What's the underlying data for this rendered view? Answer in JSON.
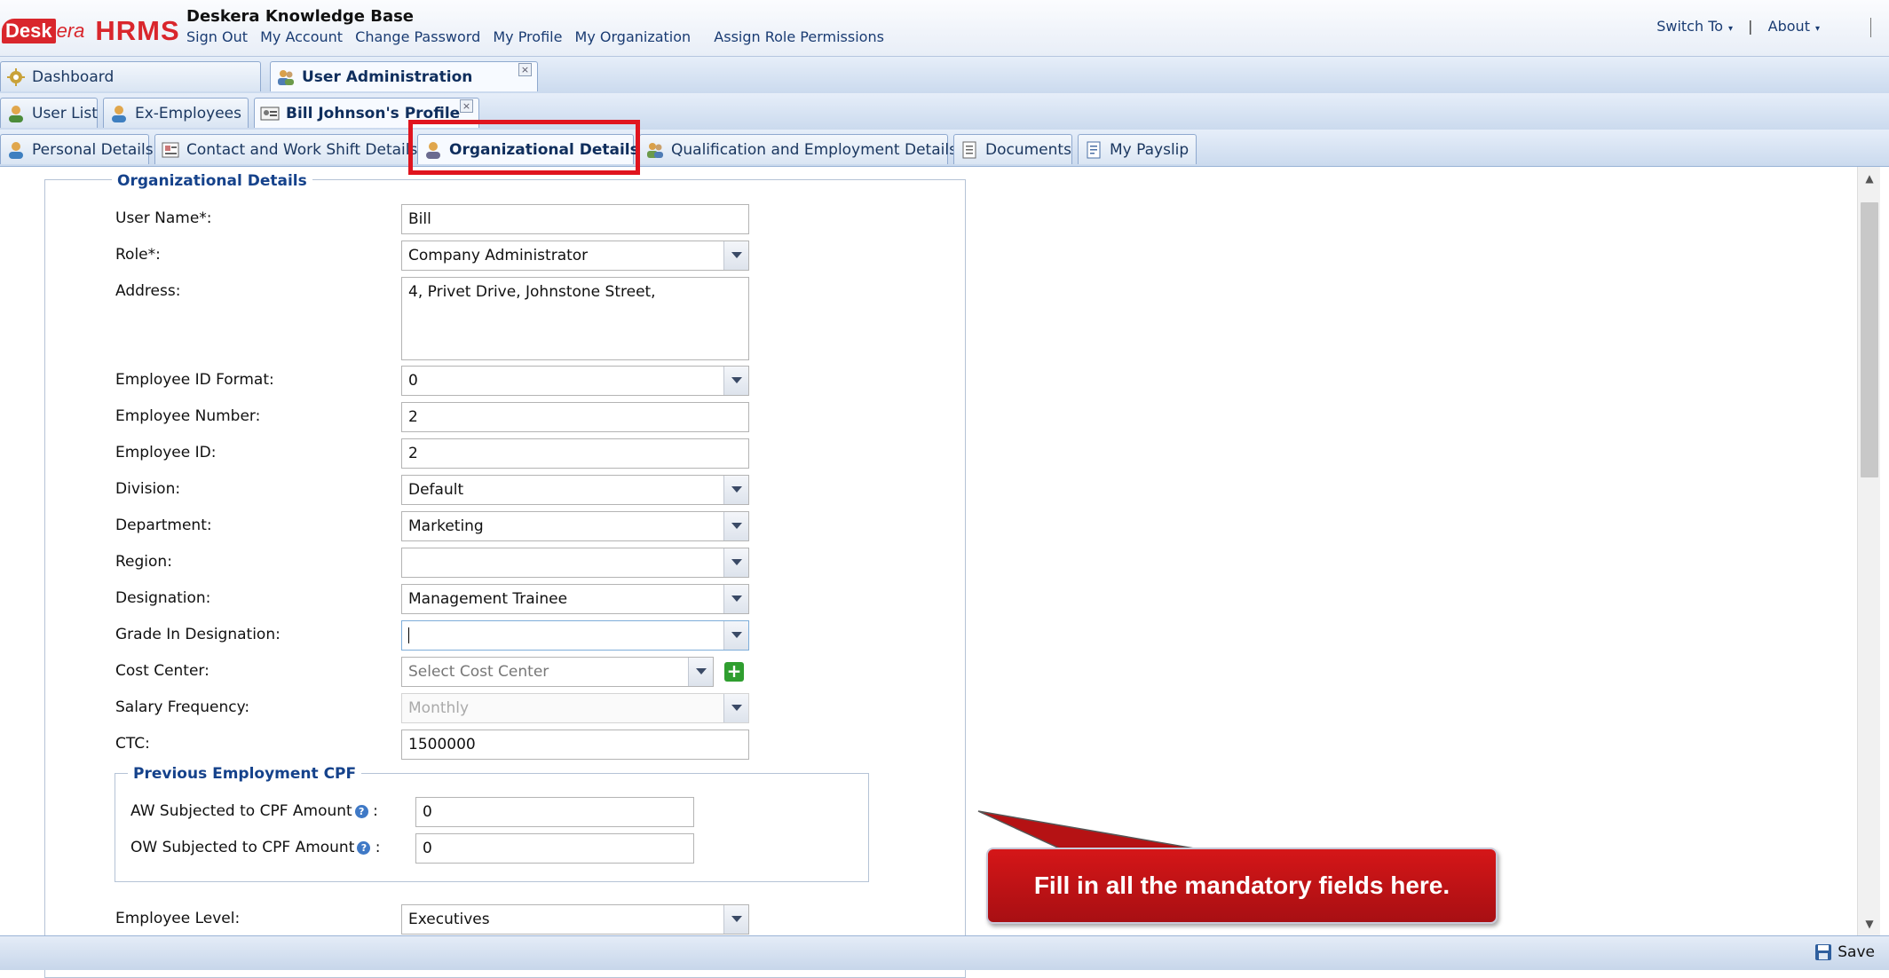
{
  "header": {
    "logo_desk": "Desk",
    "logo_era": "era",
    "logo_hrms": "HRMS",
    "title": "Deskera Knowledge Base",
    "links": [
      "Sign Out",
      "My Account",
      "Change Password",
      "My Profile",
      "My Organization",
      "Assign Role Permissions"
    ],
    "switch_to": "Switch To",
    "separator": "|",
    "about": "About"
  },
  "tabs_main": [
    {
      "label": "Dashboard"
    },
    {
      "label": "User Administration",
      "close": "×"
    }
  ],
  "tabs_users": [
    {
      "label": "User List"
    },
    {
      "label": "Ex-Employees"
    },
    {
      "label": "Bill Johnson's Profile",
      "close": "×"
    }
  ],
  "tabs_profile": [
    {
      "label": "Personal Details"
    },
    {
      "label": "Contact and Work Shift Details"
    },
    {
      "label": "Organizational Details"
    },
    {
      "label": "Qualification and Employment Details"
    },
    {
      "label": "Documents"
    },
    {
      "label": "My Payslip"
    }
  ],
  "form": {
    "legend": "Organizational Details",
    "labels": {
      "user_name": "User Name*:",
      "role": "Role*:",
      "address": "Address:",
      "emp_id_format": "Employee ID Format:",
      "emp_number": "Employee Number:",
      "emp_id": "Employee ID:",
      "division": "Division:",
      "department": "Department:",
      "region": "Region:",
      "designation": "Designation:",
      "grade": "Grade In Designation:",
      "cost_center": "Cost Center:",
      "salary_freq": "Salary Frequency:",
      "ctc": "CTC:",
      "employee_level": "Employee Level:"
    },
    "values": {
      "user_name": "Bill",
      "role": "Company Administrator",
      "address": "4, Privet Drive, Johnstone Street,",
      "emp_id_format": "0",
      "emp_number": "2",
      "emp_id": "2",
      "division": "Default",
      "department": "Marketing",
      "region": "",
      "designation": "Management Trainee",
      "grade": "",
      "ctc": "1500000",
      "employee_level": "Executives"
    },
    "placeholders": {
      "cost_center": "Select Cost Center",
      "salary_freq": "Monthly"
    },
    "prev_cpf": {
      "legend": "Previous Employment CPF",
      "aw_label": "AW Subjected to CPF Amount",
      "ow_label": "OW Subjected to CPF Amount",
      "colon": ":",
      "help": "?",
      "aw_value": "0",
      "ow_value": "0"
    },
    "add_symbol": "+"
  },
  "callout": {
    "text": "Fill in all the mandatory fields here."
  },
  "footer": {
    "save_label": "Save"
  },
  "colors": {
    "brand_red": "#d9262c",
    "highlight_red": "#e0141e",
    "link_blue": "#1a3c73",
    "legend_blue": "#15428b"
  }
}
